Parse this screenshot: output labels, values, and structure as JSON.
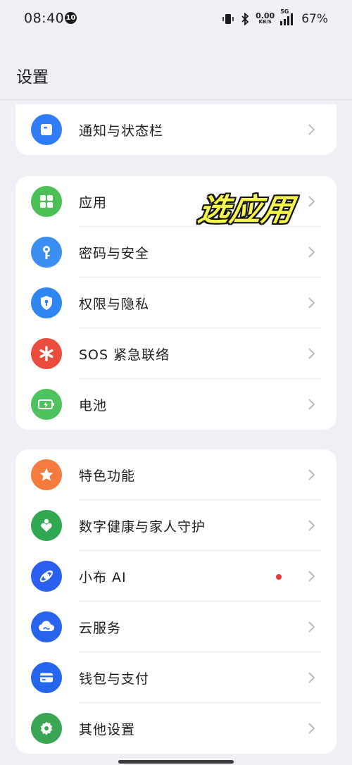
{
  "status_bar": {
    "time": "08:40",
    "notification_count": "10",
    "net_speed_value": "0.00",
    "net_speed_unit": "KB/S",
    "network_type": "5G",
    "battery_percent": "67%"
  },
  "header": {
    "title": "设置"
  },
  "overlay_annotation": "选应用",
  "groups": [
    {
      "items": [
        {
          "label": "通知与状态栏",
          "icon": "notification-icon",
          "color": "#2f7cf6"
        }
      ]
    },
    {
      "items": [
        {
          "label": "应用",
          "icon": "apps-grid-icon",
          "color": "#4cc057"
        },
        {
          "label": "密码与安全",
          "icon": "key-icon",
          "color": "#3b8ff2"
        },
        {
          "label": "权限与隐私",
          "icon": "shield-lock-icon",
          "color": "#2f86f0"
        },
        {
          "label": "SOS 紧急联络",
          "icon": "asterisk-icon",
          "color": "#ea4b3c"
        },
        {
          "label": "电池",
          "icon": "battery-icon",
          "color": "#4ec25d"
        }
      ]
    },
    {
      "items": [
        {
          "label": "特色功能",
          "icon": "star-icon",
          "color": "#f47a3e"
        },
        {
          "label": "数字健康与家人守护",
          "icon": "wellbeing-icon",
          "color": "#2fa84f"
        },
        {
          "label": "小布 AI",
          "icon": "ai-assistant-icon",
          "color": "#2b5ff0",
          "has_dot": true
        },
        {
          "label": "云服务",
          "icon": "cloud-icon",
          "color": "#2864ee"
        },
        {
          "label": "钱包与支付",
          "icon": "wallet-icon",
          "color": "#2566ee"
        },
        {
          "label": "其他设置",
          "icon": "gear-icon",
          "color": "#3aa653"
        }
      ]
    }
  ]
}
